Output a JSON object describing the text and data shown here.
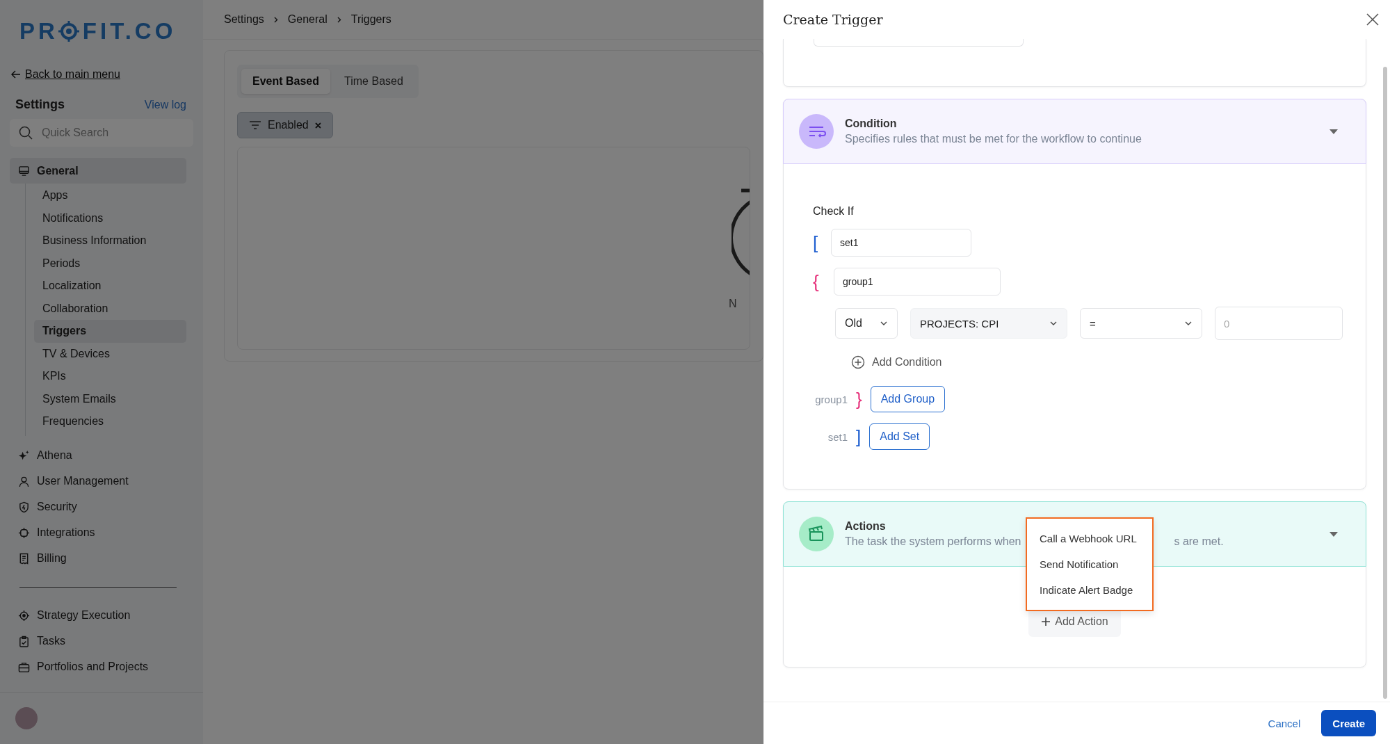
{
  "logo": {
    "before": "PR",
    "after": "FIT.CO"
  },
  "back_link": "Back to main menu",
  "settings": {
    "title": "Settings",
    "view_log": "View log"
  },
  "search": {
    "placeholder": "Quick Search"
  },
  "nav": [
    {
      "label": "General",
      "selected": true,
      "children": [
        {
          "label": "Apps",
          "selected": false
        },
        {
          "label": "Notifications",
          "selected": false
        },
        {
          "label": "Business Information",
          "selected": false
        },
        {
          "label": "Periods",
          "selected": false
        },
        {
          "label": "Localization",
          "selected": false
        },
        {
          "label": "Collaboration",
          "selected": false
        },
        {
          "label": "Triggers",
          "selected": true
        },
        {
          "label": "TV & Devices",
          "selected": false
        },
        {
          "label": "KPIs",
          "selected": false
        },
        {
          "label": "System Emails",
          "selected": false
        },
        {
          "label": "Frequencies",
          "selected": false
        }
      ]
    },
    {
      "label": "Athena",
      "selected": false
    },
    {
      "label": "User Management",
      "selected": false
    },
    {
      "label": "Security",
      "selected": false
    },
    {
      "label": "Integrations",
      "selected": false
    },
    {
      "label": "Billing",
      "selected": false
    }
  ],
  "nav_apps": [
    {
      "label": "Strategy Execution",
      "selected": false
    },
    {
      "label": "Tasks",
      "selected": false
    },
    {
      "label": "Portfolios and Projects",
      "selected": false
    }
  ],
  "breadcrumb": [
    "Settings",
    "General",
    "Triggers"
  ],
  "tabs": [
    {
      "label": "Event Based",
      "selected": true
    },
    {
      "label": "Time Based",
      "selected": false
    }
  ],
  "filter_chip": "Enabled",
  "empty_text": "N",
  "drawer": {
    "title": "Create Trigger",
    "condition": {
      "title": "Condition",
      "subtitle": "Specifies rules that must be met for the workflow to continue",
      "check_if": "Check If",
      "set_open": "[",
      "set_value": "set1",
      "group_open": "{",
      "group_value": "group1",
      "group_close_mark": "}",
      "set_close_mark": "]",
      "row": {
        "state": "Old",
        "field": "PROJECTS: CPI",
        "operator": "=",
        "value_placeholder": "0"
      },
      "add_condition": "Add Condition",
      "group_close": "group1",
      "add_group": "Add Group",
      "set_close": "set1",
      "add_set": "Add Set"
    },
    "actions": {
      "title": "Actions",
      "subtitle_before": "The task the system performs when",
      "subtitle_after": "s are met.",
      "add_action": "Add Action",
      "menu": [
        "Call a Webhook URL",
        "Send Notification",
        "Indicate Alert Badge"
      ]
    },
    "cancel": "Cancel",
    "create": "Create"
  }
}
